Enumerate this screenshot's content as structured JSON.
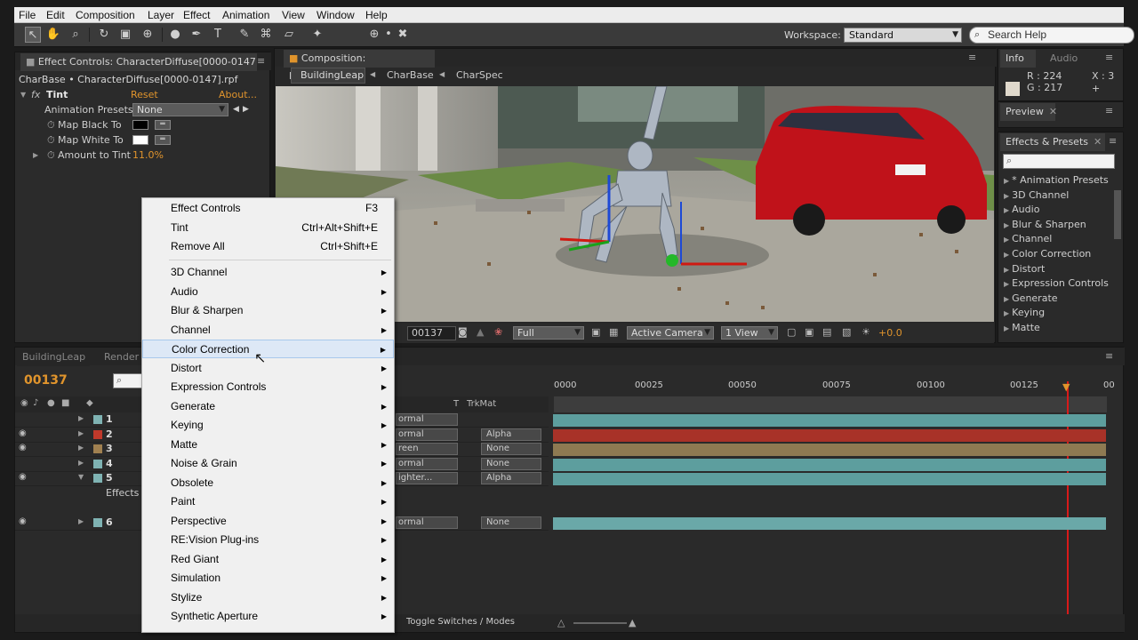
{
  "menubar": [
    "File",
    "Edit",
    "Composition",
    "Layer",
    "Effect",
    "Animation",
    "View",
    "Window",
    "Help"
  ],
  "workspace": {
    "label": "Workspace:",
    "value": "Standard"
  },
  "search": {
    "placeholder": "Search Help"
  },
  "effect_controls": {
    "tab": "Effect Controls: CharacterDiffuse[0000-0147",
    "breadcrumb": "CharBase • CharacterDiffuse[0000-0147].rpf",
    "effect_name": "Tint",
    "reset": "Reset",
    "about": "About...",
    "presets_label": "Animation Presets:",
    "presets_value": "None",
    "map_black": "Map Black To",
    "map_white": "Map White To",
    "amount_label": "Amount to Tint",
    "amount_value": "11.0%",
    "colors": {
      "black": "#000000",
      "white": "#ffffff"
    }
  },
  "composition": {
    "tab": "Composition: BuildingLeap",
    "crumbs": [
      "BuildingLeap",
      "CharBase",
      "CharSpec"
    ],
    "timecode": "00137",
    "resolution": "Full",
    "camera": "Active Camera",
    "views": "1 View",
    "exposure": "+0.0"
  },
  "info": {
    "tab_info": "Info",
    "tab_audio": "Audio",
    "r": "R : 224",
    "g": "G : 217",
    "x": "X : 3",
    "swatch": "#e0d9cc"
  },
  "preview": {
    "tab": "Preview"
  },
  "effects_presets": {
    "tab": "Effects & Presets",
    "items": [
      "* Animation Presets",
      "3D Channel",
      "Audio",
      "Blur & Sharpen",
      "Channel",
      "Color Correction",
      "Distort",
      "Expression Controls",
      "Generate",
      "Keying",
      "Matte"
    ]
  },
  "context_menu": {
    "top": [
      {
        "label": "Effect Controls",
        "shortcut": "F3"
      },
      {
        "label": "Tint",
        "shortcut": "Ctrl+Alt+Shift+E"
      },
      {
        "label": "Remove All",
        "shortcut": "Ctrl+Shift+E"
      }
    ],
    "cats": [
      "3D Channel",
      "Audio",
      "Blur & Sharpen",
      "Channel",
      "Color Correction",
      "Distort",
      "Expression Controls",
      "Generate",
      "Keying",
      "Matte",
      "Noise & Grain",
      "Obsolete",
      "Paint",
      "Perspective",
      "RE:Vision Plug-ins",
      "Red Giant",
      "Simulation",
      "Stylize",
      "Synthetic Aperture"
    ],
    "highlighted": "Color Correction"
  },
  "timeline": {
    "tab": "BuildingLeap",
    "tab2": "Render",
    "timecode": "00137",
    "col_trkmat": "TrkMat",
    "col_t": "T",
    "ticks": [
      "0000",
      "00025",
      "00050",
      "00075",
      "00100",
      "00125",
      "00"
    ],
    "layers": [
      {
        "num": "1",
        "color": "#7fb3b3",
        "mode": "ormal",
        "trk": ""
      },
      {
        "num": "2",
        "color": "#c0392b",
        "mode": "ormal",
        "trk": "Alpha"
      },
      {
        "num": "3",
        "color": "#a08050",
        "mode": "reen",
        "trk": "None"
      },
      {
        "num": "4",
        "color": "#7fb3b3",
        "mode": "ormal",
        "trk": "None"
      },
      {
        "num": "5",
        "color": "#7fb3b3",
        "mode": "ighter...",
        "trk": "Alpha"
      },
      {
        "num": "6",
        "color": "#7fb3b3",
        "mode": "ormal",
        "trk": "None"
      }
    ],
    "effects_label": "Effects",
    "toggle": "Toggle Switches / Modes",
    "bar_colors": [
      "#5d9e9e",
      "#a83228",
      "#8e7a52",
      "#5d9e9e",
      "#5d9e9e",
      "#6aa8a8"
    ]
  }
}
